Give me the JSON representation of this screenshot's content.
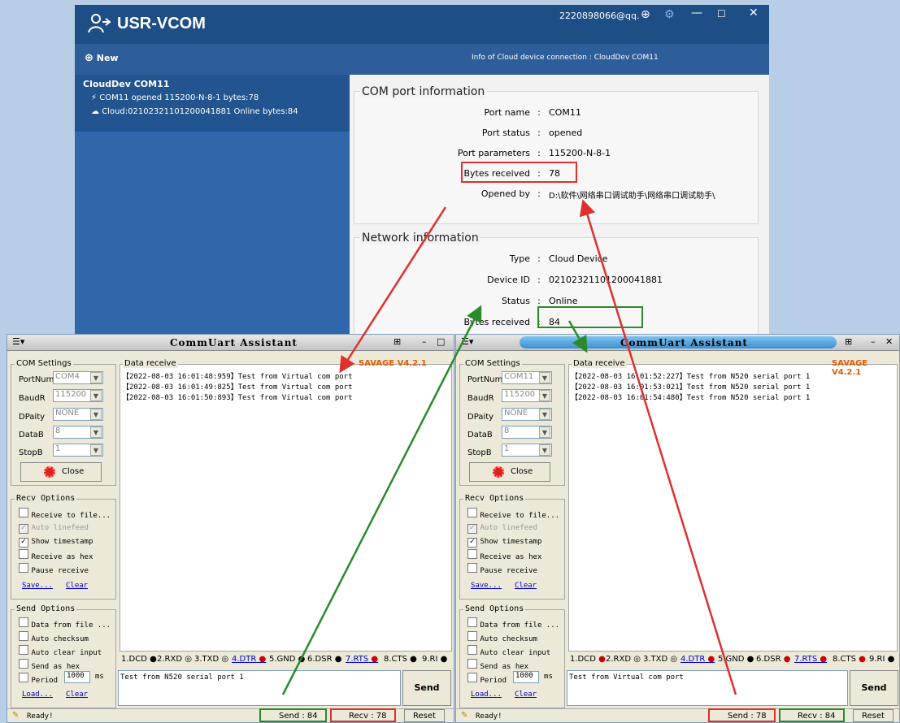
{
  "vcom": {
    "app_name": "USR-VCOM",
    "account": "2220898066@qq.",
    "new_label": "New",
    "connection_info": "Info of Cloud device connection : CloudDev COM11",
    "device": {
      "name": "CloudDev COM11",
      "line1": "COM11 opened 115200-N-8-1 bytes:78",
      "line2": "Cloud:02102321101200041881 Online bytes:84"
    },
    "com_info": {
      "title": "COM port information",
      "rows": [
        {
          "label": "Port name",
          "value": "COM11"
        },
        {
          "label": "Port status",
          "value": "opened"
        },
        {
          "label": "Port parameters",
          "value": "115200-N-8-1"
        },
        {
          "label": "Bytes received",
          "value": "78"
        },
        {
          "label": "Opened by",
          "value": "D:\\软件\\网络串口调试助手\\网络串口调试助手\\"
        }
      ]
    },
    "net_info": {
      "title": "Network information",
      "rows": [
        {
          "label": "Type",
          "value": "Cloud Device"
        },
        {
          "label": "Device ID",
          "value": "02102321101200041881"
        },
        {
          "label": "Status",
          "value": "Online"
        },
        {
          "label": "Bytes received",
          "value": "84"
        }
      ]
    },
    "colors": {
      "title": "#1e4e86",
      "sidebar": "#2f67aa",
      "highlight_red": "#e02f2f",
      "highlight_green": "#2b8a2b"
    }
  },
  "common": {
    "title": "CommUart Assistant",
    "version": "SAVAGE V4.2.1",
    "com_settings": "COM Settings",
    "data_receive": "Data receive",
    "port_label": "PortNum",
    "baud_label": "BaudR",
    "parity_label": "DPaity",
    "databits_label": "DataB",
    "stopbits_label": "StopB",
    "close_label": "Close",
    "recv_options": "Recv Options",
    "recv_opts": [
      "Receive to file...",
      "Auto linefeed",
      "Show timestamp",
      "Receive as hex",
      "Pause receive"
    ],
    "save": "Save...",
    "clear": "Clear",
    "send_options": "Send Options",
    "send_opts": [
      "Data from file ...",
      "Auto checksum",
      "Auto clear input",
      "Send as hex"
    ],
    "period_label": "Period",
    "period_value": "1000",
    "period_unit": "ms",
    "load": "Load...",
    "send_button": "Send",
    "status": "Ready!",
    "reset": "Reset",
    "signals": [
      "1.DCD",
      "2.RXD",
      "3.TXD",
      "4.DTR",
      "5.GND",
      "6.DSR",
      "7.RTS",
      "8.CTS",
      "9.RI"
    ]
  },
  "left_assistant": {
    "port": "COM4",
    "baud": "115200",
    "parity": "NONE",
    "databits": "8",
    "stopbits": "1",
    "received": [
      "【2022-08-03 16:01:48:959】Test from Virtual com port",
      "【2022-08-03 16:01:49:825】Test from Virtual com port",
      "【2022-08-03 16:01:50:893】Test from Virtual com port"
    ],
    "send_text": "Test from N520 serial port 1",
    "send_count": "Send : 84",
    "recv_count": "Recv : 78"
  },
  "right_assistant": {
    "port": "COM11",
    "baud": "115200",
    "parity": "NONE",
    "databits": "8",
    "stopbits": "1",
    "received": [
      "【2022-08-03 16:01:52:227】Test from N520 serial port 1",
      "【2022-08-03 16:01:53:021】Test from N520 serial port 1",
      "【2022-08-03 16:01:54:480】Test from N520 serial port 1"
    ],
    "send_text": "Test from Virtual com port",
    "send_count": "Send : 78",
    "recv_count": "Recv : 84"
  }
}
